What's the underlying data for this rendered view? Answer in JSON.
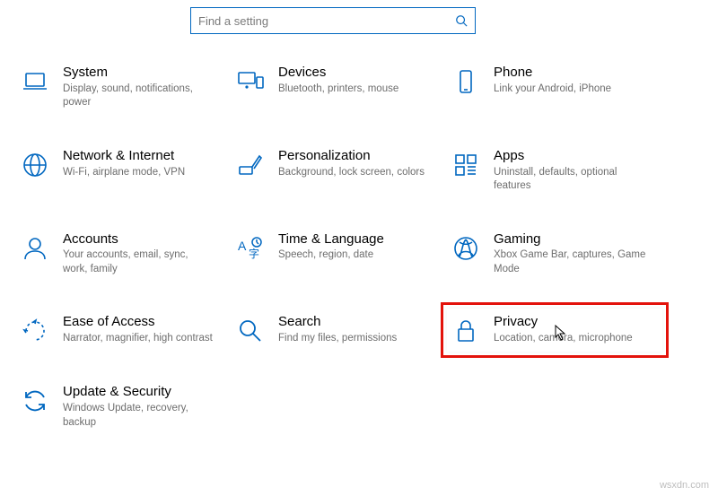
{
  "search": {
    "placeholder": "Find a setting"
  },
  "colors": {
    "accent": "#0067c0",
    "highlight": "#e3120b"
  },
  "tiles": {
    "t0": {
      "title": "System",
      "desc": "Display, sound, notifications, power"
    },
    "t1": {
      "title": "Devices",
      "desc": "Bluetooth, printers, mouse"
    },
    "t2": {
      "title": "Phone",
      "desc": "Link your Android, iPhone"
    },
    "t3": {
      "title": "Network & Internet",
      "desc": "Wi-Fi, airplane mode, VPN"
    },
    "t4": {
      "title": "Personalization",
      "desc": "Background, lock screen, colors"
    },
    "t5": {
      "title": "Apps",
      "desc": "Uninstall, defaults, optional features"
    },
    "t6": {
      "title": "Accounts",
      "desc": "Your accounts, email, sync, work, family"
    },
    "t7": {
      "title": "Time & Language",
      "desc": "Speech, region, date"
    },
    "t8": {
      "title": "Gaming",
      "desc": "Xbox Game Bar, captures, Game Mode"
    },
    "t9": {
      "title": "Ease of Access",
      "desc": "Narrator, magnifier, high contrast"
    },
    "t10": {
      "title": "Search",
      "desc": "Find my files, permissions"
    },
    "t11": {
      "title": "Privacy",
      "desc": "Location, camera, microphone"
    },
    "t12": {
      "title": "Update & Security",
      "desc": "Windows Update, recovery, backup"
    }
  },
  "watermark": "wsxdn.com"
}
